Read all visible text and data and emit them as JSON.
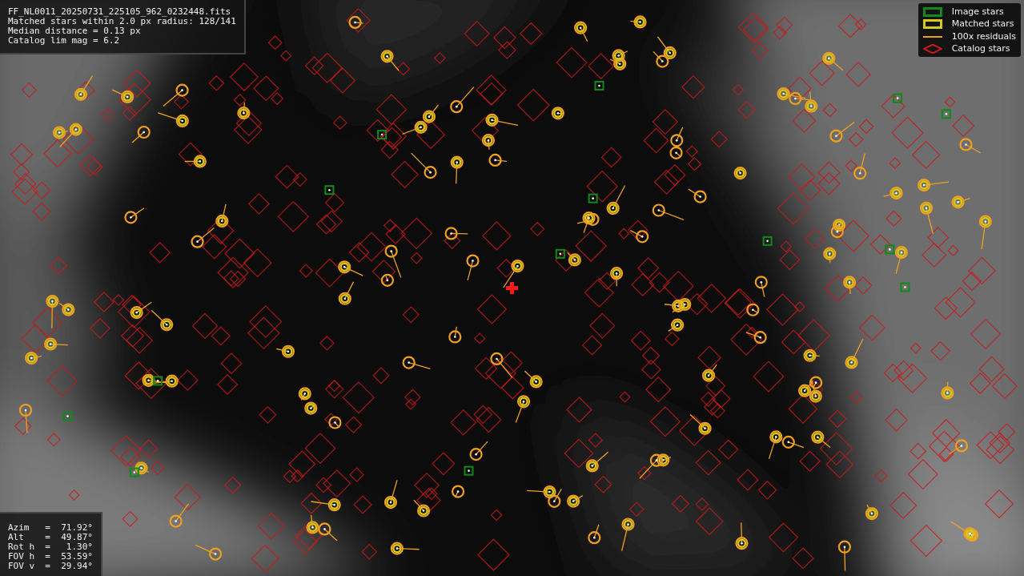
{
  "file_info": {
    "lines": [
      "FF_NL0011_20250731_225105_962_0232448.fits",
      "Matched stars within 2.0 px radius: 128/141",
      "Median distance = 0.13 px",
      "Catalog lim mag = 6.2"
    ]
  },
  "legend": {
    "items": [
      {
        "label": "Image stars",
        "color": "#0f8a1a"
      },
      {
        "label": "Matched stars",
        "kind": "matched",
        "color": "#d4c81a"
      },
      {
        "label": "100x residuals",
        "kind": "residual",
        "color": "#f0a020"
      },
      {
        "label": "Catalog stars",
        "kind": "catalog",
        "color": "#c81a1a"
      }
    ]
  },
  "pointing": {
    "lines": [
      "Azim   =  71.92°",
      "Alt    =  49.87°",
      "Rot h  =   1.30°",
      "FOV h  =  53.59°",
      "FOV v  =  29.94°"
    ]
  }
}
